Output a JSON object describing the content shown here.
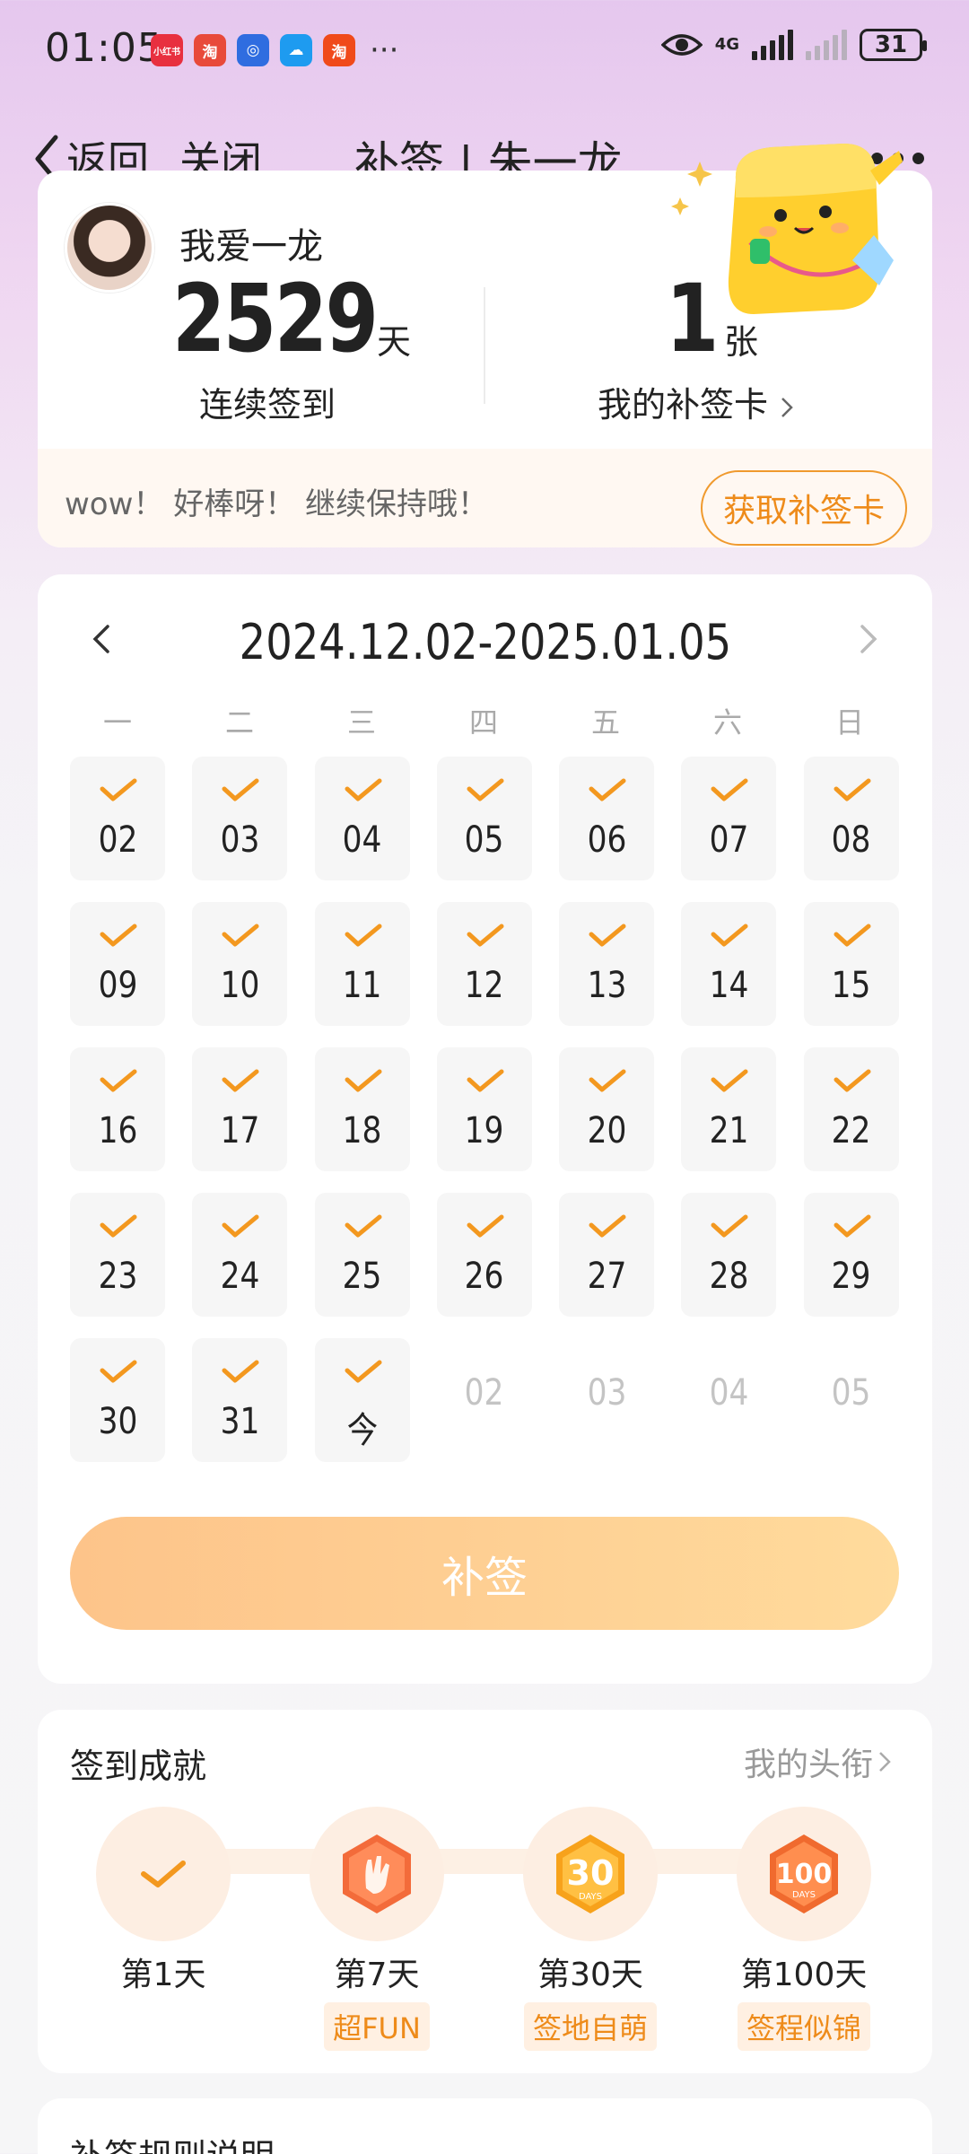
{
  "status": {
    "time": "01:05",
    "apps": [
      {
        "icon": "xiaohongshu-icon",
        "label": "小红书",
        "color": "#e8303f"
      },
      {
        "icon": "taobao-flash-icon",
        "label": "淘",
        "color": "#e84a3a"
      },
      {
        "icon": "blue-app-icon",
        "label": "◎",
        "color": "#2f6de0"
      },
      {
        "icon": "cloud-icon",
        "label": "☁",
        "color": "#1e9bf0"
      },
      {
        "icon": "taobao-icon",
        "label": "淘",
        "color": "#f04a1a"
      }
    ],
    "more": "···",
    "network": "4G",
    "battery": "31"
  },
  "nav": {
    "back": "返回",
    "close": "关闭",
    "title": "补签 | 朱一龙"
  },
  "profile": {
    "nickname": "我爱一龙",
    "streak_days": "2529",
    "streak_unit": "天",
    "streak_label": "连续签到",
    "cards_count": "1",
    "cards_unit": "张",
    "cards_label": "我的补签卡",
    "cheer": "wow！ 好棒呀！ 继续保持哦！",
    "get_card_button": "获取补签卡"
  },
  "calendar": {
    "range": "2024.12.02-2025.01.05",
    "weekdays": [
      "一",
      "二",
      "三",
      "四",
      "五",
      "六",
      "日"
    ],
    "days": [
      {
        "label": "02",
        "signed": true
      },
      {
        "label": "03",
        "signed": true
      },
      {
        "label": "04",
        "signed": true
      },
      {
        "label": "05",
        "signed": true
      },
      {
        "label": "06",
        "signed": true
      },
      {
        "label": "07",
        "signed": true
      },
      {
        "label": "08",
        "signed": true
      },
      {
        "label": "09",
        "signed": true
      },
      {
        "label": "10",
        "signed": true
      },
      {
        "label": "11",
        "signed": true
      },
      {
        "label": "12",
        "signed": true
      },
      {
        "label": "13",
        "signed": true
      },
      {
        "label": "14",
        "signed": true
      },
      {
        "label": "15",
        "signed": true
      },
      {
        "label": "16",
        "signed": true
      },
      {
        "label": "17",
        "signed": true
      },
      {
        "label": "18",
        "signed": true
      },
      {
        "label": "19",
        "signed": true
      },
      {
        "label": "20",
        "signed": true
      },
      {
        "label": "21",
        "signed": true
      },
      {
        "label": "22",
        "signed": true
      },
      {
        "label": "23",
        "signed": true
      },
      {
        "label": "24",
        "signed": true
      },
      {
        "label": "25",
        "signed": true
      },
      {
        "label": "26",
        "signed": true
      },
      {
        "label": "27",
        "signed": true
      },
      {
        "label": "28",
        "signed": true
      },
      {
        "label": "29",
        "signed": true
      },
      {
        "label": "30",
        "signed": true
      },
      {
        "label": "31",
        "signed": true
      },
      {
        "label": "今",
        "signed": true
      },
      {
        "label": "02",
        "signed": false
      },
      {
        "label": "03",
        "signed": false
      },
      {
        "label": "04",
        "signed": false
      },
      {
        "label": "05",
        "signed": false
      }
    ],
    "button": "补签"
  },
  "achievements": {
    "title": "签到成就",
    "link": "我的头衔",
    "items": [
      {
        "day": "第1天",
        "badge": "",
        "icon": "check-icon"
      },
      {
        "day": "第7天",
        "badge": "超FUN",
        "icon": "hand-gesture-badge-icon"
      },
      {
        "day": "第30天",
        "badge": "签地自萌",
        "icon": "30-days-badge-icon"
      },
      {
        "day": "第100天",
        "badge": "签程似锦",
        "icon": "100-days-badge-icon"
      }
    ]
  },
  "rules": {
    "title": "补签规则说明"
  },
  "colors": {
    "accent": "#ee8b1a",
    "check": "#f3981f",
    "button_gradient_start": "#fdc48a",
    "button_gradient_end": "#ffdb9c"
  }
}
